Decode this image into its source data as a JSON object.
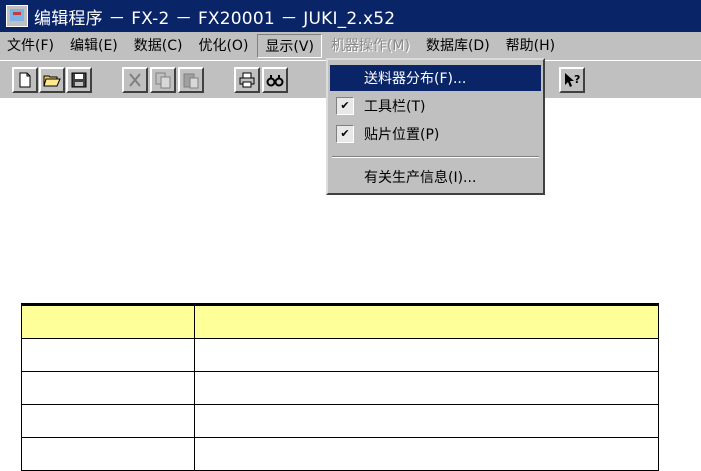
{
  "window": {
    "title": "编辑程序 － FX-2 － FX20001 － JUKI_2.x52",
    "icon": "app-edit-icon"
  },
  "menubar": {
    "items": [
      {
        "label": "文件(F)",
        "state": "normal"
      },
      {
        "label": "编辑(E)",
        "state": "normal"
      },
      {
        "label": "数据(C)",
        "state": "normal"
      },
      {
        "label": "优化(O)",
        "state": "normal"
      },
      {
        "label": "显示(V)",
        "state": "active"
      },
      {
        "label": "机器操作(M)",
        "state": "disabled"
      },
      {
        "label": "数据库(D)",
        "state": "normal"
      },
      {
        "label": "帮助(H)",
        "state": "normal"
      }
    ]
  },
  "toolbar": {
    "buttons": [
      {
        "icon": "new-file-icon"
      },
      {
        "icon": "open-folder-icon"
      },
      {
        "icon": "save-icon"
      },
      {
        "icon": "cut-icon",
        "disabled": true
      },
      {
        "icon": "copy-icon",
        "disabled": true
      },
      {
        "icon": "paste-icon",
        "disabled": true
      },
      {
        "icon": "print-icon"
      },
      {
        "icon": "find-icon"
      },
      {
        "icon": "help-pointer-icon"
      }
    ]
  },
  "dropdown": {
    "items": [
      {
        "label": "送料器分布(F)...",
        "checked": false,
        "highlighted": true
      },
      {
        "label": "工具栏(T)",
        "checked": true,
        "highlighted": false
      },
      {
        "label": "贴片位置(P)",
        "checked": true,
        "highlighted": false
      },
      {
        "label": "有关生产信息(I)...",
        "checked": false,
        "highlighted": false
      }
    ]
  },
  "colors": {
    "titlebar": "#0a2468",
    "chrome": "#c0c0c0",
    "table_header": "#ffff99"
  },
  "table": {
    "rows": [
      [
        "",
        ""
      ],
      [
        "",
        ""
      ],
      [
        "",
        ""
      ],
      [
        "",
        ""
      ],
      [
        "",
        ""
      ]
    ]
  }
}
